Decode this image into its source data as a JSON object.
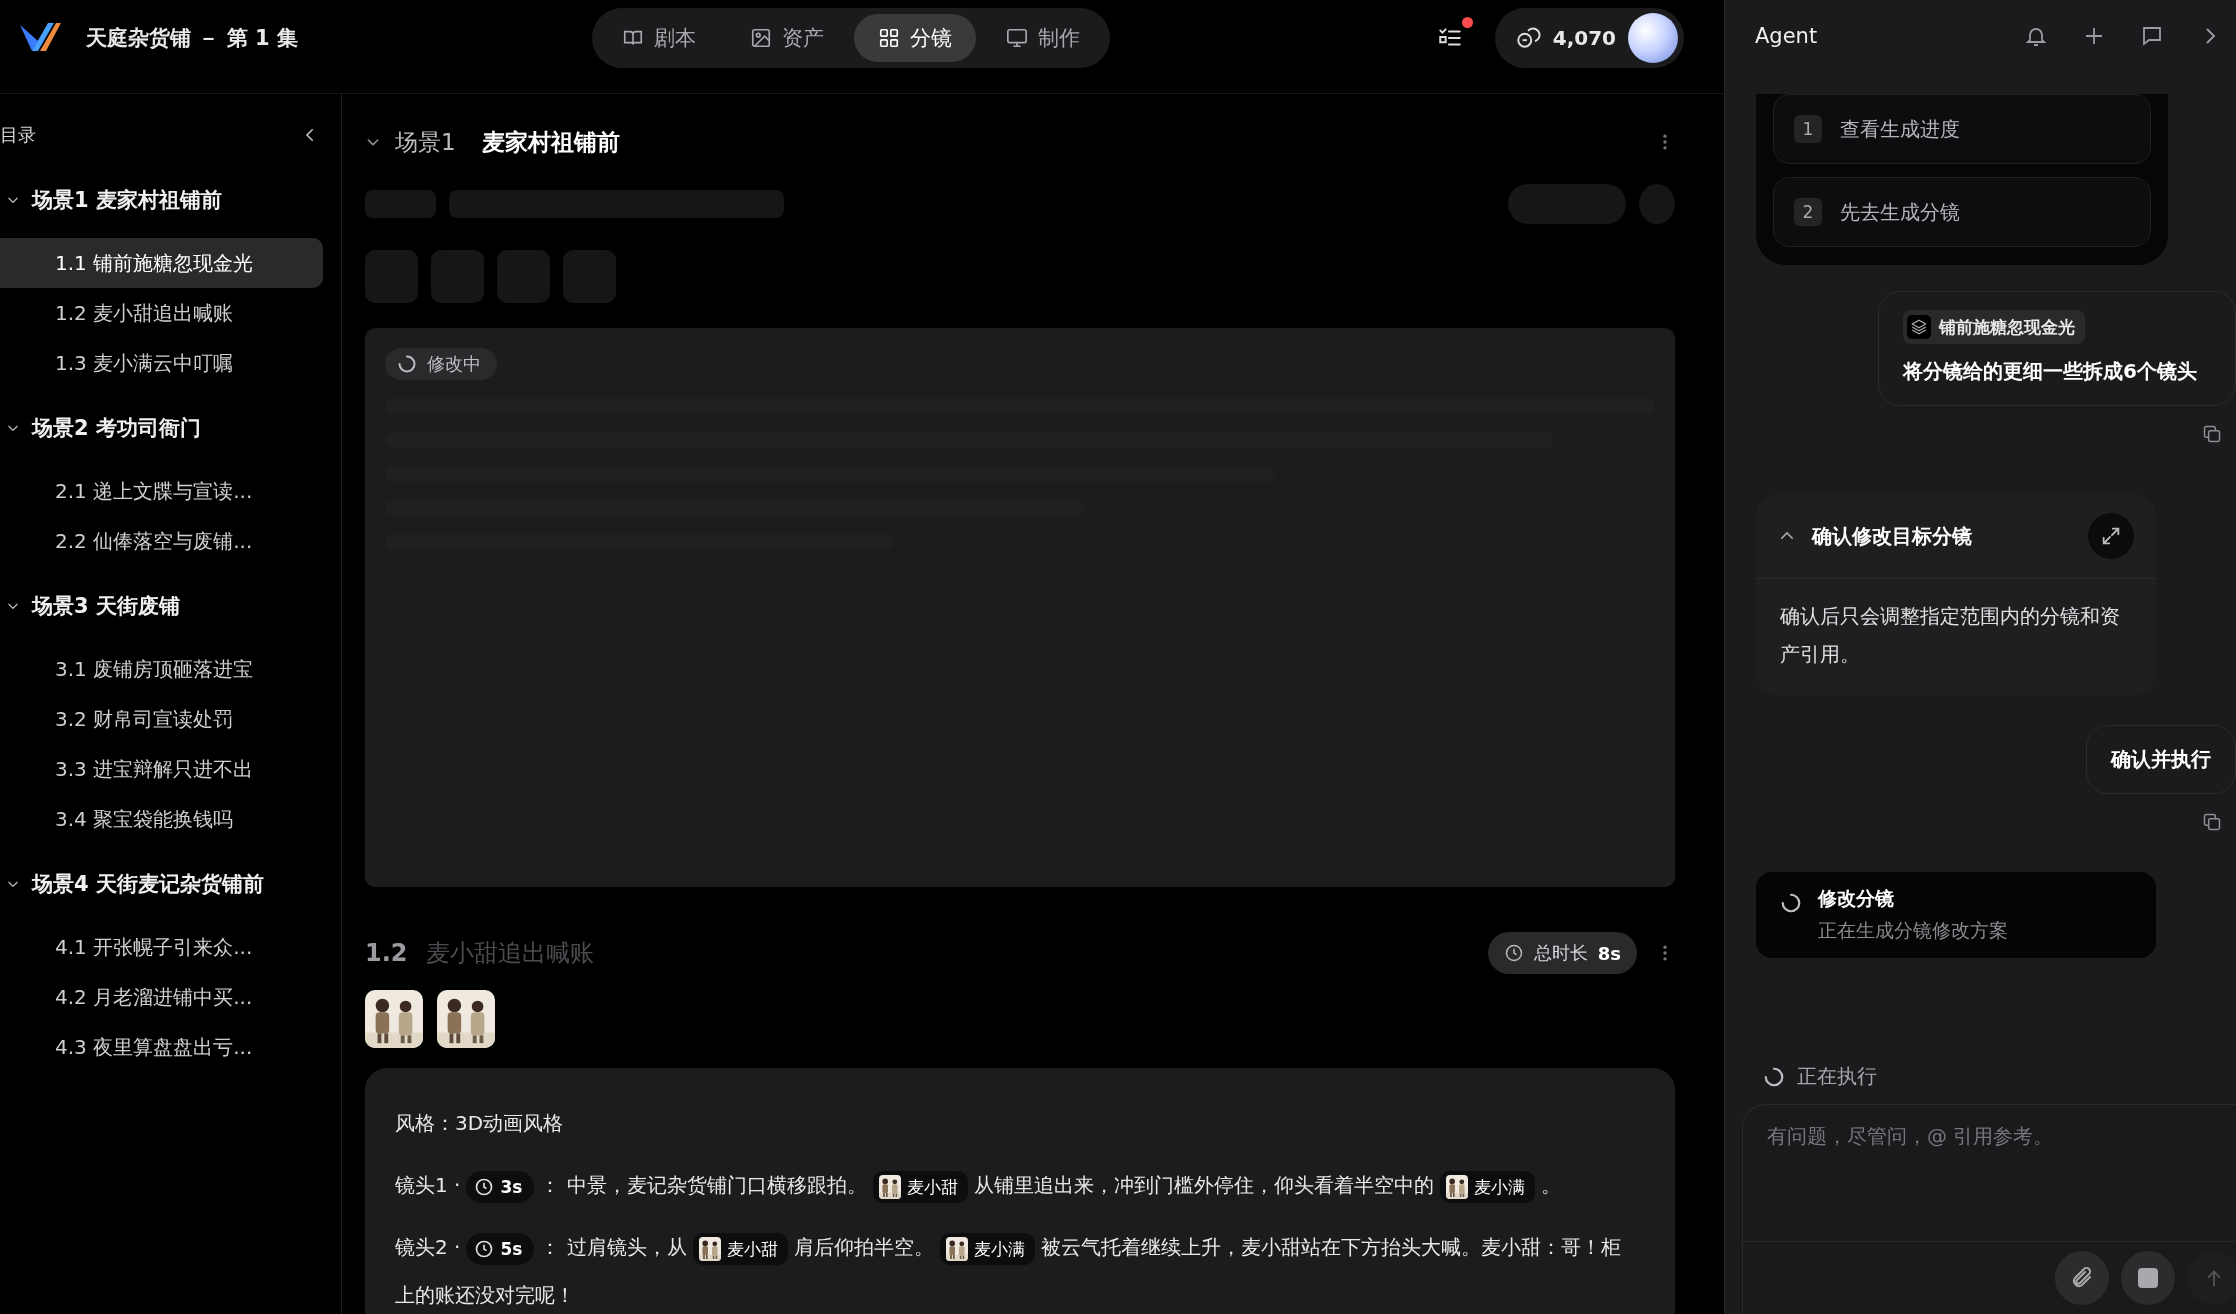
{
  "app": {
    "title": "天庭杂货铺 － 第 1 集"
  },
  "tabs": [
    {
      "label": "剧本",
      "selected": false
    },
    {
      "label": "资产",
      "selected": false
    },
    {
      "label": "分镜",
      "selected": true
    },
    {
      "label": "制作",
      "selected": false
    }
  ],
  "tasks": {
    "unread": true
  },
  "credits": "4,070",
  "sidebar": {
    "title": "目录",
    "scenes": [
      {
        "label": "场景1",
        "name": "麦家村祖铺前",
        "expanded": true,
        "children": [
          {
            "number": "1.1",
            "label": "铺前施糖忽现金光",
            "selected": true
          },
          {
            "number": "1.2",
            "label": "麦小甜追出喊账",
            "selected": false
          },
          {
            "number": "1.3",
            "label": "麦小满云中叮嘱",
            "selected": false
          }
        ]
      },
      {
        "label": "场景2",
        "name": "考功司衙门",
        "expanded": true,
        "children": [
          {
            "number": "2.1",
            "label": "递上文牒与宣读...",
            "selected": false
          },
          {
            "number": "2.2",
            "label": "仙俸落空与废铺...",
            "selected": false
          }
        ]
      },
      {
        "label": "场景3",
        "name": "天街废铺",
        "expanded": true,
        "children": [
          {
            "number": "3.1",
            "label": "废铺房顶砸落进宝",
            "selected": false
          },
          {
            "number": "3.2",
            "label": "财帛司宣读处罚",
            "selected": false
          },
          {
            "number": "3.3",
            "label": "进宝辩解只进不出",
            "selected": false
          },
          {
            "number": "3.4",
            "label": "聚宝袋能换钱吗",
            "selected": false
          }
        ]
      },
      {
        "label": "场景4",
        "name": "天街麦记杂货铺前",
        "expanded": true,
        "children": [
          {
            "number": "4.1",
            "label": "开张幌子引来众...",
            "selected": false
          },
          {
            "number": "4.2",
            "label": "月老溜进铺中买...",
            "selected": false
          },
          {
            "number": "4.3",
            "label": "夜里算盘盘出亏...",
            "selected": false
          }
        ]
      }
    ]
  },
  "main": {
    "scene": {
      "label": "场景1",
      "name": "麦家村祖铺前",
      "expanded": true
    },
    "loading_card": {
      "status": "修改中"
    },
    "shot_group": {
      "number": "1.2",
      "title": "麦小甜追出喊账",
      "duration_label": "总时长",
      "duration": "8s",
      "style": "风格：3D动画风格",
      "shots": [
        {
          "label": "镜头1 ·",
          "duration": "3s",
          "segments": [
            {
              "kind": "text",
              "text": "： 中景，麦记杂货铺门口横移跟拍。"
            },
            {
              "kind": "character",
              "text": "麦小甜"
            },
            {
              "kind": "text",
              "text": "从铺里追出来，冲到门槛外停住，仰头看着半空中的"
            },
            {
              "kind": "character",
              "text": "麦小满"
            },
            {
              "kind": "text",
              "text": "。"
            }
          ]
        },
        {
          "label": "镜头2 ·",
          "duration": "5s",
          "segments": [
            {
              "kind": "text",
              "text": "： 过肩镜头，从"
            },
            {
              "kind": "character",
              "text": "麦小甜"
            },
            {
              "kind": "text",
              "text": "肩后仰拍半空。"
            },
            {
              "kind": "character",
              "text": "麦小满"
            },
            {
              "kind": "text",
              "text": "被云气托着继续上升，麦小甜站在下方抬头大喊。麦小甜：哥！柜"
            },
            {
              "kind": "text",
              "text": "上的账还没对完呢！"
            }
          ]
        }
      ]
    }
  },
  "agent": {
    "title": "Agent",
    "options": [
      {
        "number": "1",
        "label": "查看生成进度"
      },
      {
        "number": "2",
        "label": "先去生成分镜"
      }
    ],
    "messages": [
      {
        "kind": "user",
        "reference": "铺前施糖忽现金光",
        "text": "将分镜给的更细一些拆成6个镜头"
      },
      {
        "kind": "confirm",
        "title": "确认修改目标分镜",
        "expanded": true,
        "body": "确认后只会调整指定范围内的分镜和资产引用。"
      },
      {
        "kind": "user",
        "text": "确认并执行"
      },
      {
        "kind": "task",
        "title": "修改分镜",
        "subtitle": "正在生成分镜修改方案"
      }
    ],
    "status": "正在执行",
    "input": {
      "placeholder": "有问题，尽管问，@ 引用参考。"
    }
  }
}
